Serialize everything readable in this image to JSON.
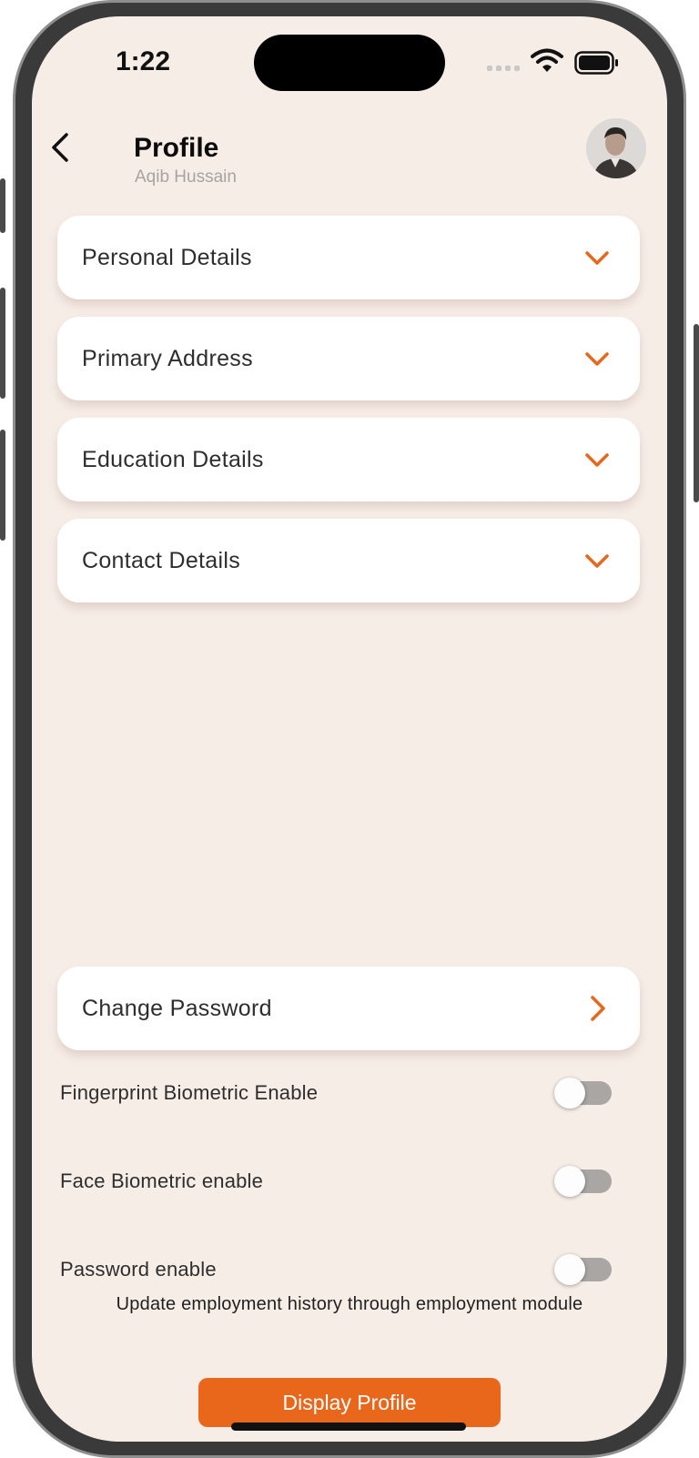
{
  "status_bar": {
    "time": "1:22",
    "icons": [
      "cellular-signal-icon",
      "wifi-icon",
      "battery-icon"
    ]
  },
  "header": {
    "title": "Profile",
    "subtitle": "Aqib  Hussain",
    "back_icon": "chevron-left-icon",
    "avatar": "user-avatar"
  },
  "sections": [
    {
      "label": "Personal Details",
      "icon": "chevron-down-icon"
    },
    {
      "label": "Primary Address",
      "icon": "chevron-down-icon"
    },
    {
      "label": "Education Details",
      "icon": "chevron-down-icon"
    },
    {
      "label": "Contact Details",
      "icon": "chevron-down-icon"
    }
  ],
  "change_password": {
    "label": "Change Password",
    "icon": "chevron-right-icon"
  },
  "toggles": [
    {
      "label": "Fingerprint Biometric Enable",
      "enabled": false
    },
    {
      "label": "Face Biometric enable",
      "enabled": false
    },
    {
      "label": "Password enable",
      "enabled": false
    }
  ],
  "note": "Update employment history through employment module",
  "primary_button": {
    "label": "Display Profile"
  },
  "colors": {
    "accent": "#e8671a",
    "background": "#f7ede7",
    "card": "#ffffff",
    "toggle_off": "#a9a6a4"
  }
}
